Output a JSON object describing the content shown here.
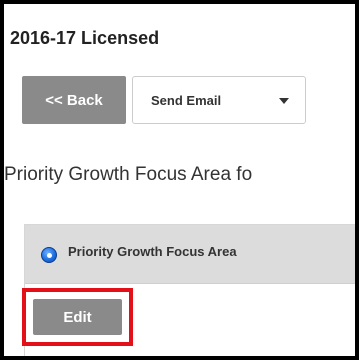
{
  "page": {
    "title": "2016-17 Licensed",
    "heading": "Priority Growth Focus Area fo"
  },
  "toolbar": {
    "back_label": "<< Back",
    "send_email_label": "Send Email",
    "send_email_icon": "caret-down-icon"
  },
  "panel": {
    "title": "Priority Growth Focus Area",
    "icon": "radio-selected-icon",
    "edit_label": "Edit"
  },
  "colors": {
    "button_gray": "#8a8a8a",
    "panel_header": "#dcdcdc",
    "highlight_red": "#e3101a",
    "radio_blue": "#1f6fe0",
    "frame_border": "#000000"
  }
}
